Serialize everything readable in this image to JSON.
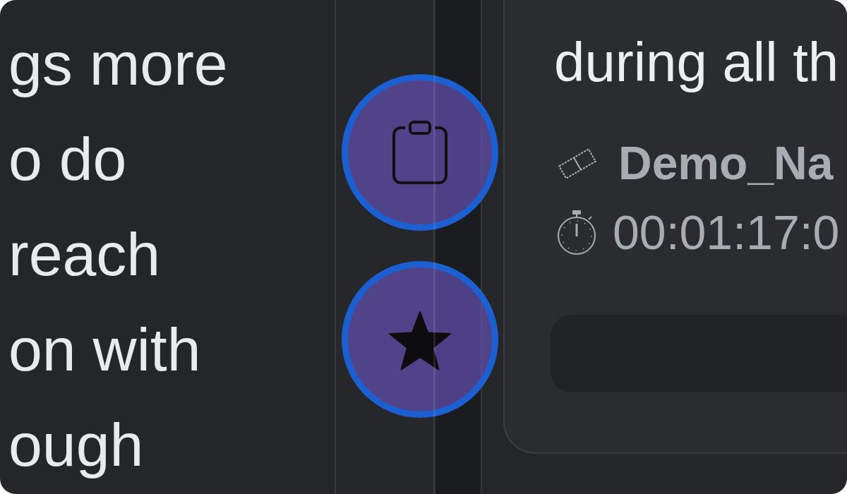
{
  "left_panel": {
    "lines": [
      "gs more",
      "o do",
      "reach",
      "on with",
      "ough"
    ]
  },
  "card": {
    "text": "during all th",
    "name": "Demo_Na",
    "duration": "00:01:17:0"
  }
}
